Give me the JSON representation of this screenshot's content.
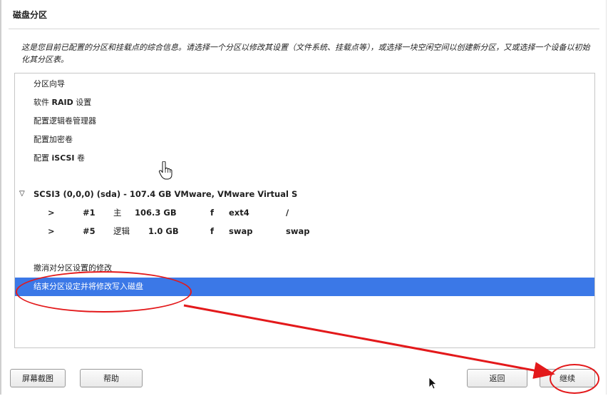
{
  "window": {
    "title": "磁盘分区",
    "description": "这是您目前已配置的分区和挂载点的综合信息。请选择一个分区以修改其设置（文件系统、挂载点等），或选择一块空闲空间以创建新分区，又或选择一个设备以初始化其分区表。"
  },
  "menu_items": [
    {
      "label": "分区向导"
    },
    {
      "label_prefix": "软件 ",
      "label_bold": "RAID",
      "label_suffix": " 设置"
    },
    {
      "label": "配置逻辑卷管理器"
    },
    {
      "label": "配置加密卷"
    },
    {
      "label_prefix": "配置 ",
      "label_bold": "iSCSI",
      "label_suffix": " 卷"
    }
  ],
  "disk": {
    "expand_icon": "triangle-down-icon",
    "label": "SCSI3 (0,0,0) (sda) - 107.4 GB VMware, VMware Virtual S",
    "partitions": [
      {
        "arrow": ">",
        "number": "#1",
        "type": "主",
        "size": "106.3 GB",
        "flag": "f",
        "fs": "ext4",
        "mount": "/"
      },
      {
        "arrow": ">",
        "number": "#5",
        "type": "逻辑",
        "size": "1.0 GB",
        "flag": "f",
        "fs": "swap",
        "mount": "swap"
      }
    ]
  },
  "actions": {
    "undo": "撤消对分区设置的修改",
    "finish": "结束分区设定并将修改写入磁盘"
  },
  "buttons": {
    "screenshot": "屏幕截图",
    "help": "帮助",
    "back": "返回",
    "continue": "继续"
  },
  "colors": {
    "selection": "#3b78e7",
    "annotation": "#e3191b"
  }
}
